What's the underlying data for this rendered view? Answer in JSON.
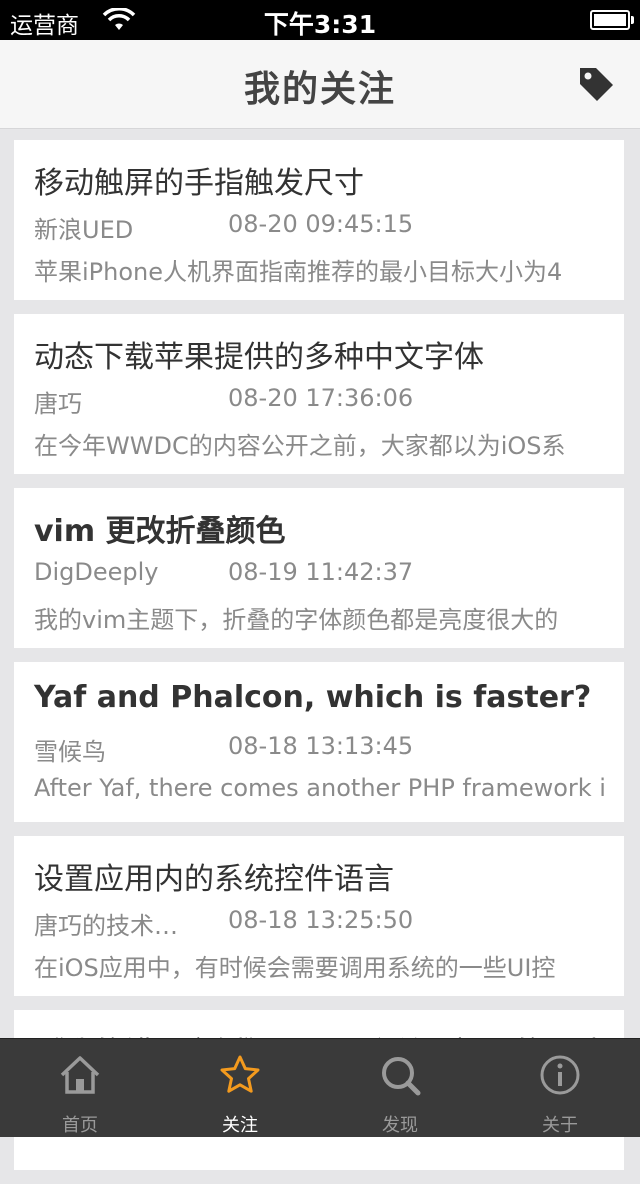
{
  "status_bar": {
    "carrier": "运营商",
    "time": "下午3:31"
  },
  "nav": {
    "title": "我的关注"
  },
  "articles": [
    {
      "title": "移动触屏的手指触发尺寸",
      "author": "新浪UED",
      "date": "08-20 09:45:15",
      "summary": "苹果iPhone人机界面指南推荐的最小目标大小为4"
    },
    {
      "title": "动态下载苹果提供的多种中文字体",
      "author": "唐巧",
      "date": "08-20 17:36:06",
      "summary": "在今年WWDC的内容公开之前，大家都以为iOS系"
    },
    {
      "title": "vim 更改折叠颜色",
      "author": "DigDeeply",
      "date": "08-19 11:42:37",
      "summary": "我的vim主题下，折叠的字体颜色都是亮度很大的"
    },
    {
      "title": "Yaf and Phalcon, which is faster?",
      "author": "雪候鸟",
      "date": "08-18 13:13:45",
      "summary": "After Yaf, there comes another PHP framework i"
    },
    {
      "title": "设置应用内的系统控件语言",
      "author": "唐巧的技术…",
      "date": "08-18 13:25:50",
      "summary": "在iOS应用中，有时候会需要调用系统的一些UI控"
    },
    {
      "title": "《我的错误案例》——一个关于提醒的设计",
      "author": "",
      "date": "",
      "summary": ""
    }
  ],
  "tabs": [
    {
      "label": "首页",
      "icon": "home-icon",
      "active": false
    },
    {
      "label": "关注",
      "icon": "star-icon",
      "active": true
    },
    {
      "label": "发现",
      "icon": "search-icon",
      "active": false
    },
    {
      "label": "关于",
      "icon": "info-icon",
      "active": false
    }
  ],
  "colors": {
    "accent": "#f39a1e",
    "tabbar": "#3a3a3a",
    "text": "#333333",
    "meta": "#8a8a8a"
  }
}
